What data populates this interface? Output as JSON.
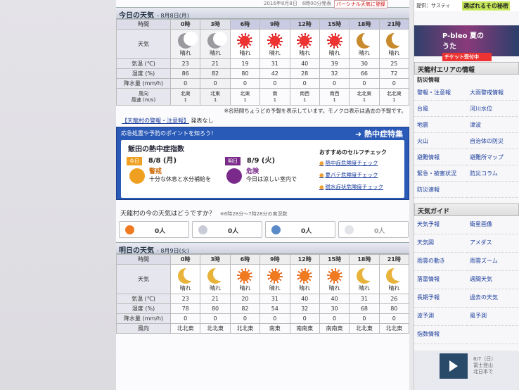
{
  "top": {
    "timestamp": "2016年8月8日　6時00分発表",
    "ad": "バーシナル天気に登録"
  },
  "today": {
    "title": "今日の天気",
    "date": "- 8月8日(月)",
    "row_labels": [
      "時間",
      "天気",
      "気温 (℃)",
      "湿度 (%)",
      "降水量 (mm/h)",
      "風向",
      "風速 (m/s)"
    ],
    "hours": [
      "0時",
      "3時",
      "6時",
      "9時",
      "12時",
      "15時",
      "18時",
      "21時"
    ],
    "icons": [
      "moon-grey-icon",
      "moon-grey-icon",
      "sun-red-icon",
      "sun-red-icon",
      "sun-red-icon",
      "sun-red-icon",
      "moon-brown-icon",
      "moon-brown-icon"
    ],
    "conditions": [
      "晴れ",
      "晴れ",
      "晴れ",
      "晴れ",
      "晴れ",
      "晴れ",
      "晴れ",
      "晴れ"
    ],
    "temps": [
      "23",
      "21",
      "19",
      "31",
      "40",
      "39",
      "30",
      "25"
    ],
    "humidity": [
      "86",
      "82",
      "80",
      "42",
      "28",
      "32",
      "66",
      "72"
    ],
    "precip": [
      "0",
      "0",
      "0",
      "0",
      "0",
      "0",
      "0",
      "0"
    ],
    "wind_dir": [
      "北東",
      "北東",
      "北東",
      "南",
      "南西",
      "南西",
      "北北東",
      "北北東"
    ],
    "wind_speed": [
      "1",
      "1",
      "1",
      "1",
      "1",
      "1",
      "1",
      "1"
    ]
  },
  "note": "※名時間ちょうどの予報を表示しています。モノクロ表示は過去の予報です。",
  "alert": {
    "link": "【天龍村の警報・注意報】",
    "status": "発表なし"
  },
  "heat": {
    "banner": "応急処置や予防のポイントを知ろう！",
    "feature": "熱中症特集",
    "title": "飯田の熱中症指数",
    "today_tag": "今日",
    "today_date": "8/8 (月)",
    "today_level": "警戒",
    "today_desc": "十分な休息と水分補給を",
    "tomorrow_tag": "明日",
    "tomorrow_date": "8/9 (火)",
    "tomorrow_level": "危険",
    "tomorrow_desc": "今日は涼しい室内で",
    "rec_title": "おすすめのセルフチェック",
    "rec_items": [
      "熱中症危険度チェック",
      "夏バテ危険度チェック",
      "脱水症状危険度チェック"
    ],
    "colors": {
      "banner": "#2a5ab8",
      "caution": "#f0a020",
      "danger": "#7a2a8a"
    }
  },
  "poll": {
    "question": "天龍村の今の天気はどうですか？",
    "sub": "※6時28分〜7時28分の実況数",
    "counts": [
      "0人",
      "0人",
      "0人",
      "0人"
    ],
    "icons": [
      "sun-icon",
      "cloud-icon",
      "rain-icon",
      "snow-icon"
    ]
  },
  "tomorrow": {
    "title": "明日の天気",
    "date": "- 8月9日(火)",
    "row_labels": [
      "時間",
      "天気",
      "気温 (℃)",
      "湿度 (%)",
      "降水量 (mm/h)",
      "風向"
    ],
    "hours": [
      "0時",
      "3時",
      "6時",
      "9時",
      "12時",
      "15時",
      "18時",
      "21時"
    ],
    "icons": [
      "moon-y-icon",
      "moon-y-icon",
      "sun-or-icon",
      "sun-or-icon",
      "sun-or-icon",
      "sun-or-icon",
      "moon-y-icon",
      "moon-y-icon"
    ],
    "conditions": [
      "晴れ",
      "晴れ",
      "晴れ",
      "晴れ",
      "晴れ",
      "晴れ",
      "晴れ",
      "晴れ"
    ],
    "temps": [
      "23",
      "21",
      "20",
      "31",
      "40",
      "40",
      "31",
      "26"
    ],
    "humidity": [
      "78",
      "80",
      "82",
      "54",
      "32",
      "30",
      "68",
      "80"
    ],
    "precip": [
      "0",
      "0",
      "0",
      "0",
      "0",
      "0",
      "0",
      "0"
    ],
    "wind_dir": [
      "北北東",
      "北北東",
      "北北東",
      "南東",
      "南南東",
      "南南東",
      "北北東",
      "北北東"
    ]
  },
  "sidebar": {
    "ad1_prefix": "提供：サスティ",
    "ad1_headline": "選ばれるその秘密",
    "ad2_title": "P-bleo 夏のうた",
    "ad2_sub": "チケット受付中",
    "area_title": "天龍村エリアの情報",
    "disaster_title": "防災情報",
    "disaster_items": [
      "警報・注意報",
      "大雨警戒情報",
      "台風",
      "河川水位",
      "地震",
      "津波",
      "火山",
      "自治体の防災",
      "避難情報",
      "避難所マップ",
      "緊急・被害状況",
      "防災コラム",
      "防災速報",
      ""
    ],
    "guide_title": "天気ガイド",
    "guide_items": [
      "天気予報",
      "衛星画像",
      "天気図",
      "アメダス",
      "雨雲の動き",
      "雨雲ズーム",
      "落雷情報",
      "週間天気",
      "長期予報",
      "過去の天気",
      "波予測",
      "風予測",
      "指数情報",
      ""
    ],
    "foot_text": [
      "8/7（日）",
      "富士登山",
      "北日本で"
    ]
  }
}
